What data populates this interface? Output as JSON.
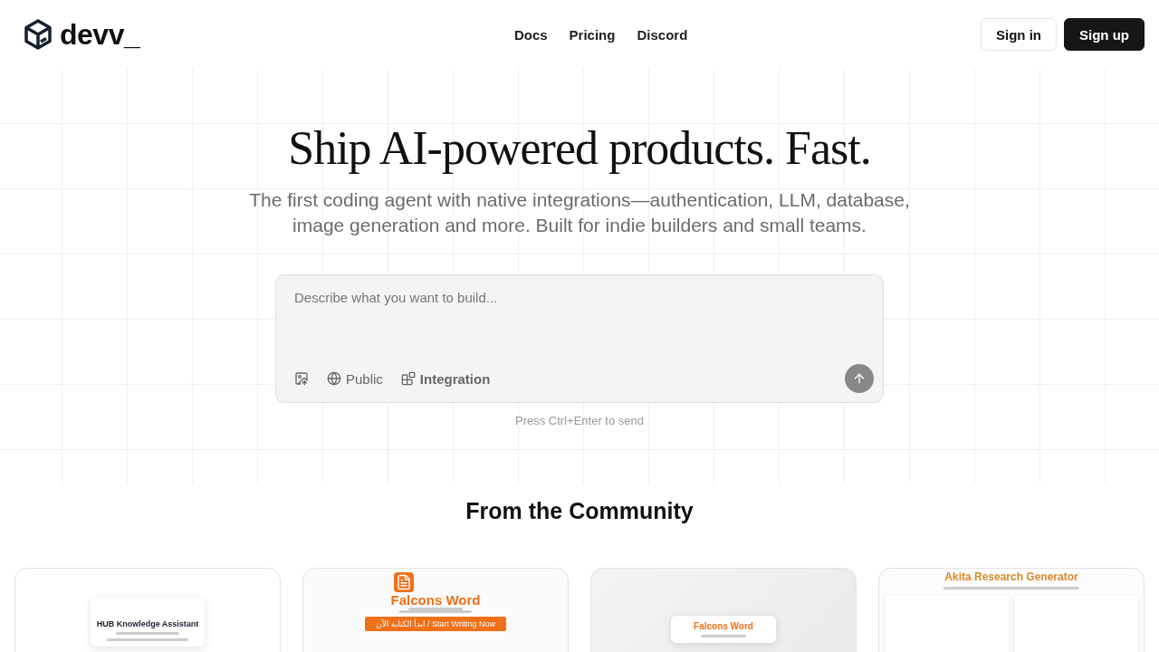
{
  "header": {
    "logo": "devv_",
    "nav": [
      "Docs",
      "Pricing",
      "Discord"
    ],
    "buttons": [
      {
        "label": "Sign in",
        "kind": "outline"
      },
      {
        "label": "Sign up",
        "kind": "solid"
      }
    ]
  },
  "hero": {
    "title": "Ship AI-powered products. Fast.",
    "subtitle": "The first coding agent with native integrations—authentication, LLM, database, image generation and more. Built for indie builders and small teams."
  },
  "prompt": {
    "placeholder": "Describe what you want to build...",
    "tools": [
      {
        "kind": "upload"
      },
      {
        "kind": "visibility",
        "label": "Public"
      },
      {
        "kind": "integration",
        "label": "Integration"
      }
    ],
    "hint": "Press Ctrl+Enter to send"
  },
  "community": {
    "title": "From the Community",
    "cards": [
      {
        "kind": "login",
        "title": "HUB Knowledge Assistant"
      },
      {
        "kind": "landing",
        "title": "Falcons Word",
        "button": "ابدأ الكتابة الآن / Start Writing Now"
      },
      {
        "kind": "dialog",
        "title": "Falcons Word"
      },
      {
        "kind": "form",
        "title": "Akita Research Generator"
      }
    ]
  }
}
